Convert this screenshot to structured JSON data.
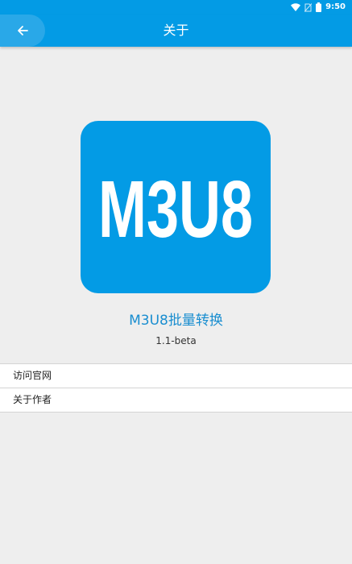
{
  "status_bar": {
    "time": "9:50",
    "icons": [
      "wifi-icon",
      "no-sim-icon",
      "battery-icon"
    ]
  },
  "app_bar": {
    "title": "关于",
    "back_icon": "arrow-left-icon"
  },
  "logo": {
    "text": "M3U8"
  },
  "app_info": {
    "name": "M3U8批量转换",
    "version": "1.1-beta"
  },
  "menu": {
    "items": [
      {
        "label": "访问官网"
      },
      {
        "label": "关于作者"
      }
    ]
  },
  "colors": {
    "primary": "#039be5",
    "accent_text": "#1a8ed0",
    "background": "#eeeeee"
  }
}
